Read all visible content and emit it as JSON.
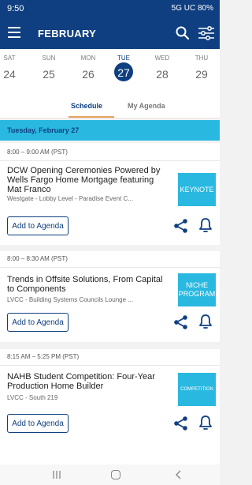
{
  "status_bar": {
    "time": "9:50",
    "indicators": "5G UC 80%"
  },
  "header": {
    "title": "FEBRUARY",
    "menu_icon": "menu-icon",
    "search_icon": "search-icon",
    "filter_icon": "filter-icon"
  },
  "days": [
    {
      "name": "SAT",
      "num": "24"
    },
    {
      "name": "SUN",
      "num": "25"
    },
    {
      "name": "MON",
      "num": "26"
    },
    {
      "name": "TUE",
      "num": "27",
      "selected": true
    },
    {
      "name": "WED",
      "num": "28"
    },
    {
      "name": "THU",
      "num": "29"
    }
  ],
  "tabs": {
    "schedule": "Schedule",
    "my_agenda": "My Agenda"
  },
  "date_header": "Tuesday, February 27",
  "add_label": "Add to Agenda",
  "events": [
    {
      "time": "8:00 – 9:00 AM (PST)",
      "title": "DCW Opening Ceremonies Powered by Wells Fargo Home Mortgage featuring Mat Franco",
      "location": "Westgate - Lobby Level - Paradise Event C...",
      "tag": "KEYNOTE"
    },
    {
      "time": "8:00 – 8:30 AM (PST)",
      "title": "Trends in Offsite Solutions, From Capital to Components",
      "location": "LVCC - Building Systems Councils Lounge ...",
      "tag": "NICHE PROGRAM"
    },
    {
      "time": "8:15 AM – 5:25 PM (PST)",
      "title": "NAHB Student Competition: Four-Year Production Home Builder",
      "location": "LVCC - South 219",
      "tag": "COMPETITION"
    }
  ],
  "colors": {
    "primary": "#0f3f80",
    "accent": "#29b8e0",
    "tab_underline": "#e8a25e"
  }
}
